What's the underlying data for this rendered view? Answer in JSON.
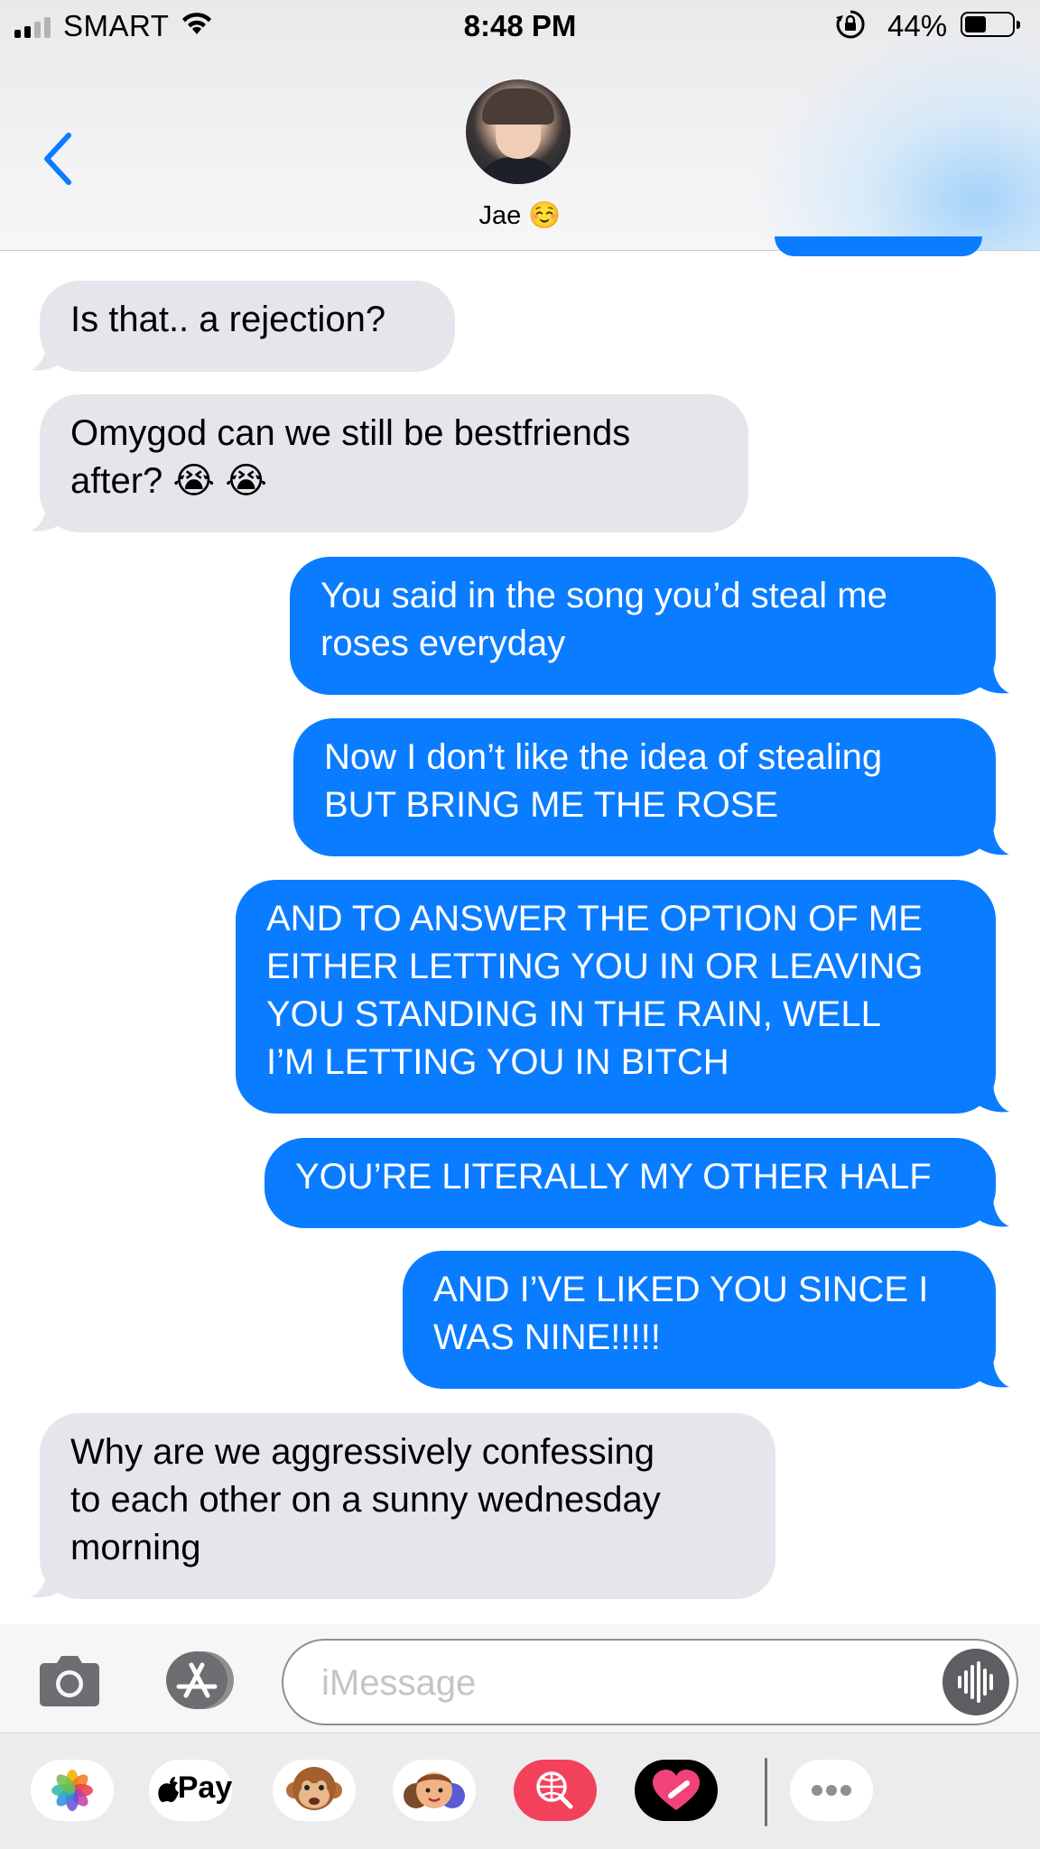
{
  "status_bar": {
    "carrier": "SMART",
    "time": "8:48 PM",
    "battery_percent": "44%",
    "battery_level": 0.44
  },
  "header": {
    "contact_name": "Jae ☺️"
  },
  "messages": [
    {
      "direction": "incoming",
      "text": "Is that.. a rejection?"
    },
    {
      "direction": "incoming",
      "lines": [
        "Omygod can we still be bestfriends",
        "after? 😭 😭"
      ]
    },
    {
      "direction": "outgoing",
      "lines": [
        "You said in the song you’d steal me",
        "roses everyday"
      ]
    },
    {
      "direction": "outgoing",
      "lines": [
        "Now I don’t like the idea of stealing",
        "BUT BRING ME THE ROSE"
      ]
    },
    {
      "direction": "outgoing",
      "lines": [
        "AND TO ANSWER THE OPTION OF ME",
        "EITHER LETTING YOU IN OR LEAVING",
        "YOU STANDING IN THE RAIN, WELL",
        "I’M LETTING YOU IN BITCH"
      ]
    },
    {
      "direction": "outgoing",
      "text": "YOU’RE LITERALLY MY OTHER HALF"
    },
    {
      "direction": "outgoing",
      "lines": [
        "AND I’VE LIKED YOU SINCE I",
        "WAS NINE!!!!!"
      ]
    },
    {
      "direction": "incoming",
      "lines": [
        "Why are we aggressively confessing",
        "to each other on a sunny wednesday",
        "morning"
      ]
    }
  ],
  "composer": {
    "placeholder": "iMessage"
  },
  "app_drawer": {
    "apps": [
      "photos-app",
      "apple-pay-app",
      "animoji-app",
      "memoji-app",
      "web-images-app",
      "digital-touch-app",
      "more-apps"
    ],
    "apple_pay_label": "Pay"
  },
  "colors": {
    "outgoing_bubble": "#0a7cff",
    "incoming_bubble": "#e6e5eb",
    "accent": "#0a7cff"
  }
}
